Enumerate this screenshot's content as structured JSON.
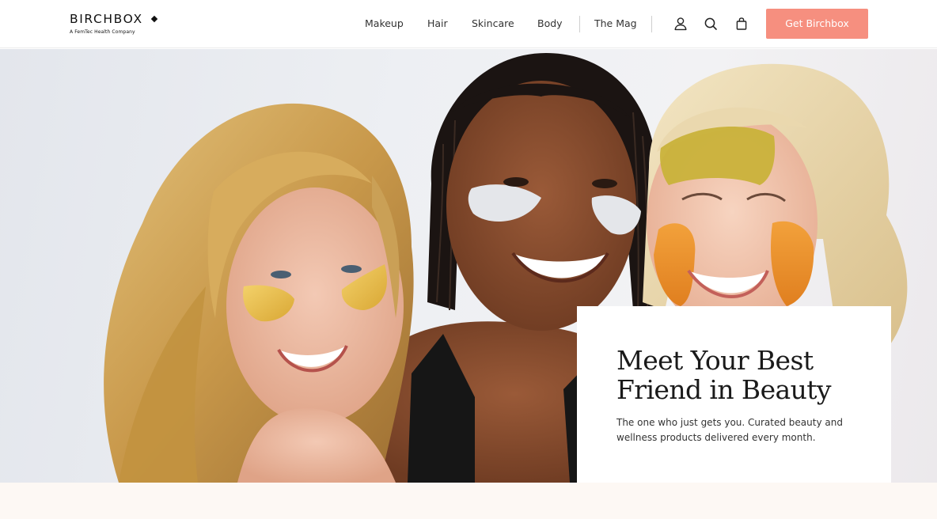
{
  "brand": {
    "name": "BIRCHBOX",
    "tagline": "A FemTec Health Company"
  },
  "nav": {
    "items": [
      "Makeup",
      "Hair",
      "Skincare",
      "Body",
      "The Mag"
    ]
  },
  "icons": {
    "account": "user-icon",
    "search": "search-icon",
    "cart": "bag-icon"
  },
  "cta": {
    "label": "Get Birchbox",
    "color": "#f68f7f"
  },
  "hero": {
    "title": "Meet Your Best Friend in Beauty",
    "subtitle": "The one who just gets you. Curated beauty and wellness products delivered every month."
  },
  "colors": {
    "accent": "#f68f7f",
    "section_background": "#fdf8f4"
  }
}
